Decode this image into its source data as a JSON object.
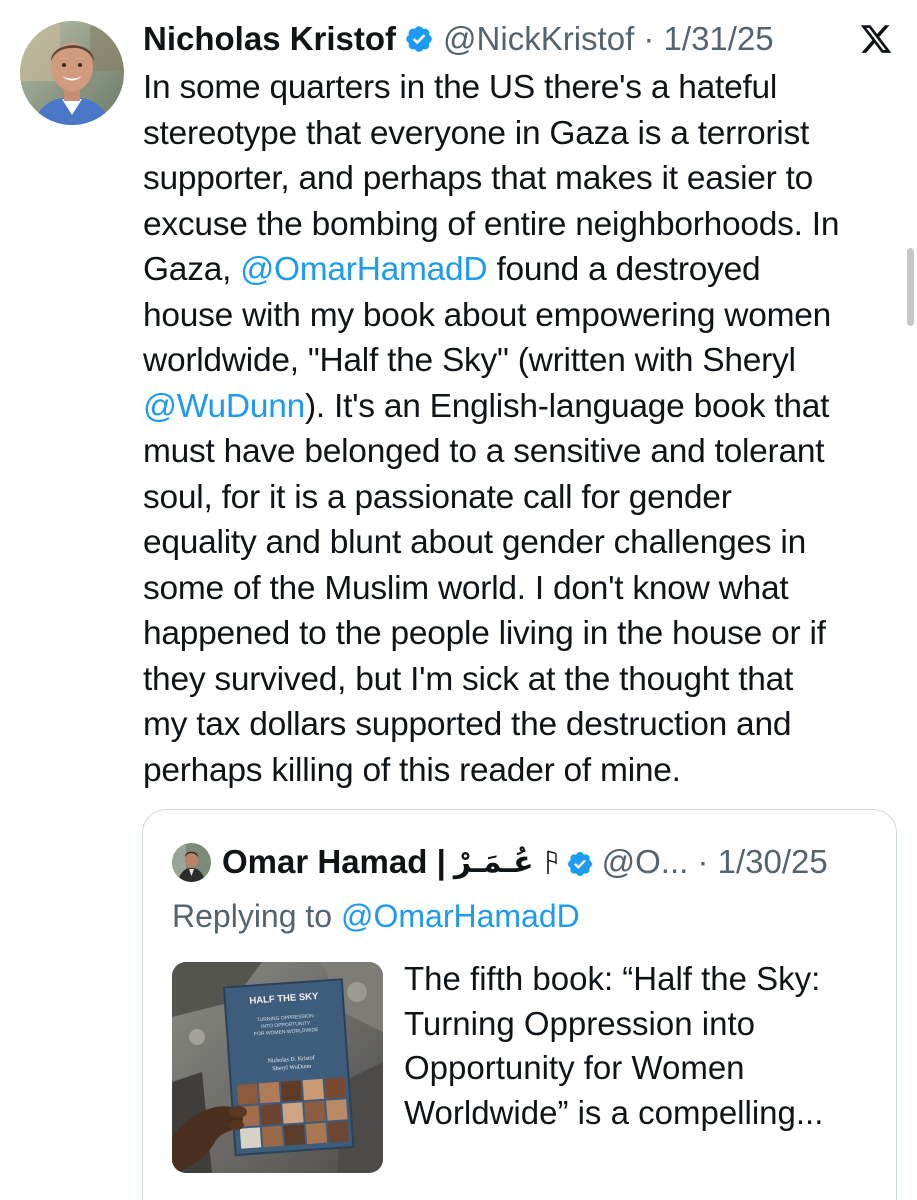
{
  "tweet": {
    "author_name": "Nicholas Kristof",
    "handle_date": "@NickKristof · 1/31/25",
    "lines": [
      [
        {
          "t": "In some quarters in the US there's a hateful"
        }
      ],
      [
        {
          "t": "stereotype that everyone in Gaza is a terrorist"
        }
      ],
      [
        {
          "t": "supporter, and perhaps that makes it easier to"
        }
      ],
      [
        {
          "t": "excuse the bombing of entire neighborhoods. In"
        }
      ],
      [
        {
          "t": "Gaza, "
        },
        {
          "t": "@OmarHamadD",
          "mention": true
        },
        {
          "t": " found a destroyed"
        }
      ],
      [
        {
          "t": "house with my book about empowering women"
        }
      ],
      [
        {
          "t": "worldwide, \"Half the Sky\" (written with Sheryl"
        }
      ],
      [
        {
          "t": "@WuDunn",
          "mention": true
        },
        {
          "t": "). It's an English-language book that"
        }
      ],
      [
        {
          "t": "must have belonged to a sensitive and tolerant"
        }
      ],
      [
        {
          "t": "soul, for it is a passionate call for gender"
        }
      ],
      [
        {
          "t": "equality and blunt about gender challenges in"
        }
      ],
      [
        {
          "t": "some of the Muslim world. I don't know what"
        }
      ],
      [
        {
          "t": "happened to the people living in the house or if"
        }
      ],
      [
        {
          "t": "they survived, but I'm sick at the thought that"
        }
      ],
      [
        {
          "t": "my tax dollars supported the destruction and"
        }
      ],
      [
        {
          "t": "perhaps killing of this reader of mine."
        }
      ]
    ]
  },
  "quote": {
    "author_name": "Omar Hamad |",
    "author_name_arabic": "عُـمَـرْ",
    "handle_date": "@O... · 1/30/25",
    "replying_prefix": "Replying to ",
    "replying_handle": "@OmarHamadD",
    "text_lines": [
      "The fifth book: “Half the Sky:",
      "Turning Oppression into",
      "Opportunity for Women",
      "Worldwide” is a compelling..."
    ],
    "book_cover": {
      "title": "HALF THE SKY",
      "subtitle_lines": [
        "TURNING OPPRESSION",
        "INTO OPPORTUNITY",
        "FOR WOMEN WORLDWIDE"
      ],
      "authors_lines": [
        "Nicholas D. Kristof",
        "Sheryl WuDunn"
      ]
    }
  },
  "icons": {
    "verified": "verified-badge-icon",
    "x_logo": "x-logo-icon",
    "flag": "flag-icon"
  },
  "colors": {
    "accent": "#1d9bf0",
    "text": "#0f1419",
    "muted": "#536471",
    "border": "#cfd9de"
  }
}
